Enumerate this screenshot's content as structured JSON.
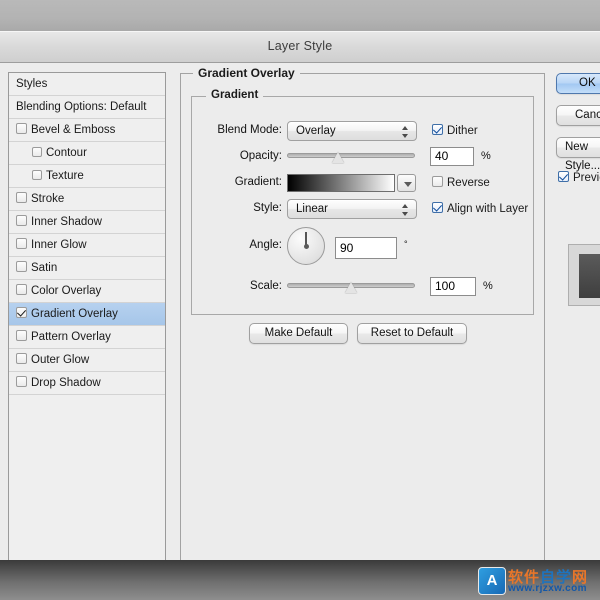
{
  "window": {
    "title": "Layer Style"
  },
  "styles_panel": {
    "header": "Styles",
    "blending_options": "Blending Options: Default",
    "items": [
      {
        "label": "Bevel & Emboss",
        "checked": false,
        "indent": false,
        "selected": false
      },
      {
        "label": "Contour",
        "checked": false,
        "indent": true,
        "selected": false
      },
      {
        "label": "Texture",
        "checked": false,
        "indent": true,
        "selected": false
      },
      {
        "label": "Stroke",
        "checked": false,
        "indent": false,
        "selected": false
      },
      {
        "label": "Inner Shadow",
        "checked": false,
        "indent": false,
        "selected": false
      },
      {
        "label": "Inner Glow",
        "checked": false,
        "indent": false,
        "selected": false
      },
      {
        "label": "Satin",
        "checked": false,
        "indent": false,
        "selected": false
      },
      {
        "label": "Color Overlay",
        "checked": false,
        "indent": false,
        "selected": false
      },
      {
        "label": "Gradient Overlay",
        "checked": true,
        "indent": false,
        "selected": true
      },
      {
        "label": "Pattern Overlay",
        "checked": false,
        "indent": false,
        "selected": false
      },
      {
        "label": "Outer Glow",
        "checked": false,
        "indent": false,
        "selected": false
      },
      {
        "label": "Drop Shadow",
        "checked": false,
        "indent": false,
        "selected": false
      }
    ]
  },
  "main": {
    "group_title": "Gradient Overlay",
    "sub_group_title": "Gradient",
    "blend_mode": {
      "label": "Blend Mode:",
      "value": "Overlay"
    },
    "dither": {
      "label": "Dither",
      "checked": true
    },
    "opacity": {
      "label": "Opacity:",
      "value": "40",
      "unit": "%",
      "percent": 40
    },
    "gradient": {
      "label": "Gradient:",
      "from": "#000000",
      "to": "#ffffff"
    },
    "reverse": {
      "label": "Reverse",
      "checked": false
    },
    "style": {
      "label": "Style:",
      "value": "Linear"
    },
    "align_with_layer": {
      "label": "Align with Layer",
      "checked": true
    },
    "angle": {
      "label": "Angle:",
      "value": "90",
      "unit": "°",
      "degrees": 90
    },
    "scale": {
      "label": "Scale:",
      "value": "100",
      "unit": "%",
      "percent": 50
    },
    "make_default": "Make Default",
    "reset_to_default": "Reset to Default"
  },
  "actions": {
    "ok": "OK",
    "cancel": "Cancel",
    "new_style": "New Style...",
    "preview": {
      "label": "Preview",
      "checked": true
    }
  },
  "watermark": {
    "badge": "A",
    "text_orange_1": "软件",
    "text_blue": "自学",
    "text_orange_2": "网",
    "url": "www.rjzxw.com"
  },
  "colors": {
    "selection": "#a6c6e9",
    "accent": "#4f78ad",
    "watermark_orange": "#e8762a"
  }
}
